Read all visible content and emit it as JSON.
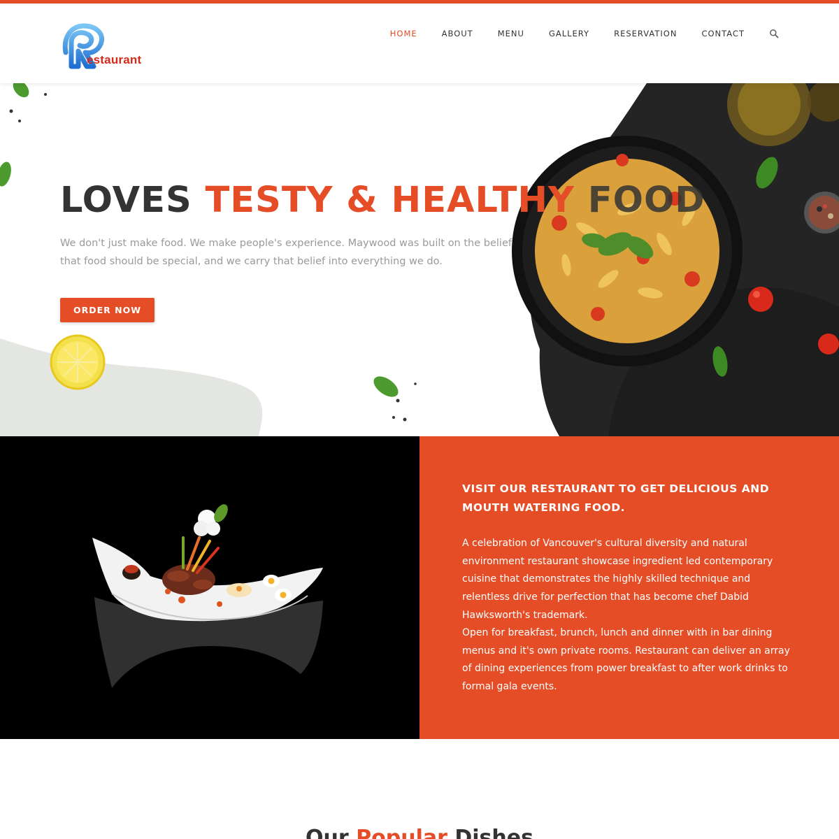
{
  "brand": {
    "logo_text": "estaurant",
    "accent_color": "#e44d26",
    "logo_color": "#d42a1c"
  },
  "nav": {
    "items": [
      {
        "label": "HOME",
        "active": true
      },
      {
        "label": "ABOUT",
        "active": false
      },
      {
        "label": "MENU",
        "active": false
      },
      {
        "label": "GALLERY",
        "active": false
      },
      {
        "label": "RESERVATION",
        "active": false
      },
      {
        "label": "CONTACT",
        "active": false
      }
    ],
    "search_icon": "search-icon"
  },
  "hero": {
    "title_part1": "LOVES ",
    "title_part2": "TESTY & HEALTHY ",
    "title_part3": "FOOD",
    "text": "We don't just make food. We make people's experience. Maywood was built on the belief that food should be special, and we carry that belief into everything we do.",
    "button_label": "ORDER NOW"
  },
  "about": {
    "heading": "VISIT OUR RESTAURANT TO GET DELICIOUS AND MOUTH WATERING FOOD.",
    "paragraph1": "A celebration of Vancouver's cultural diversity and natural environment restaurant showcase ingredient led contemporary cuisine that demonstrates the highly skilled technique and relentless drive for perfection that has become chef Dabid Hawksworth's trademark.",
    "paragraph2": "Open for breakfast, brunch, lunch and dinner with in bar dining menus and it's own private rooms. Restaurant can deliver an array of dining experiences from power breakfast to after work drinks to formal gala events."
  },
  "popular": {
    "title_part1": "Our ",
    "title_part2": "Popular",
    "title_part3": " Dishes"
  }
}
